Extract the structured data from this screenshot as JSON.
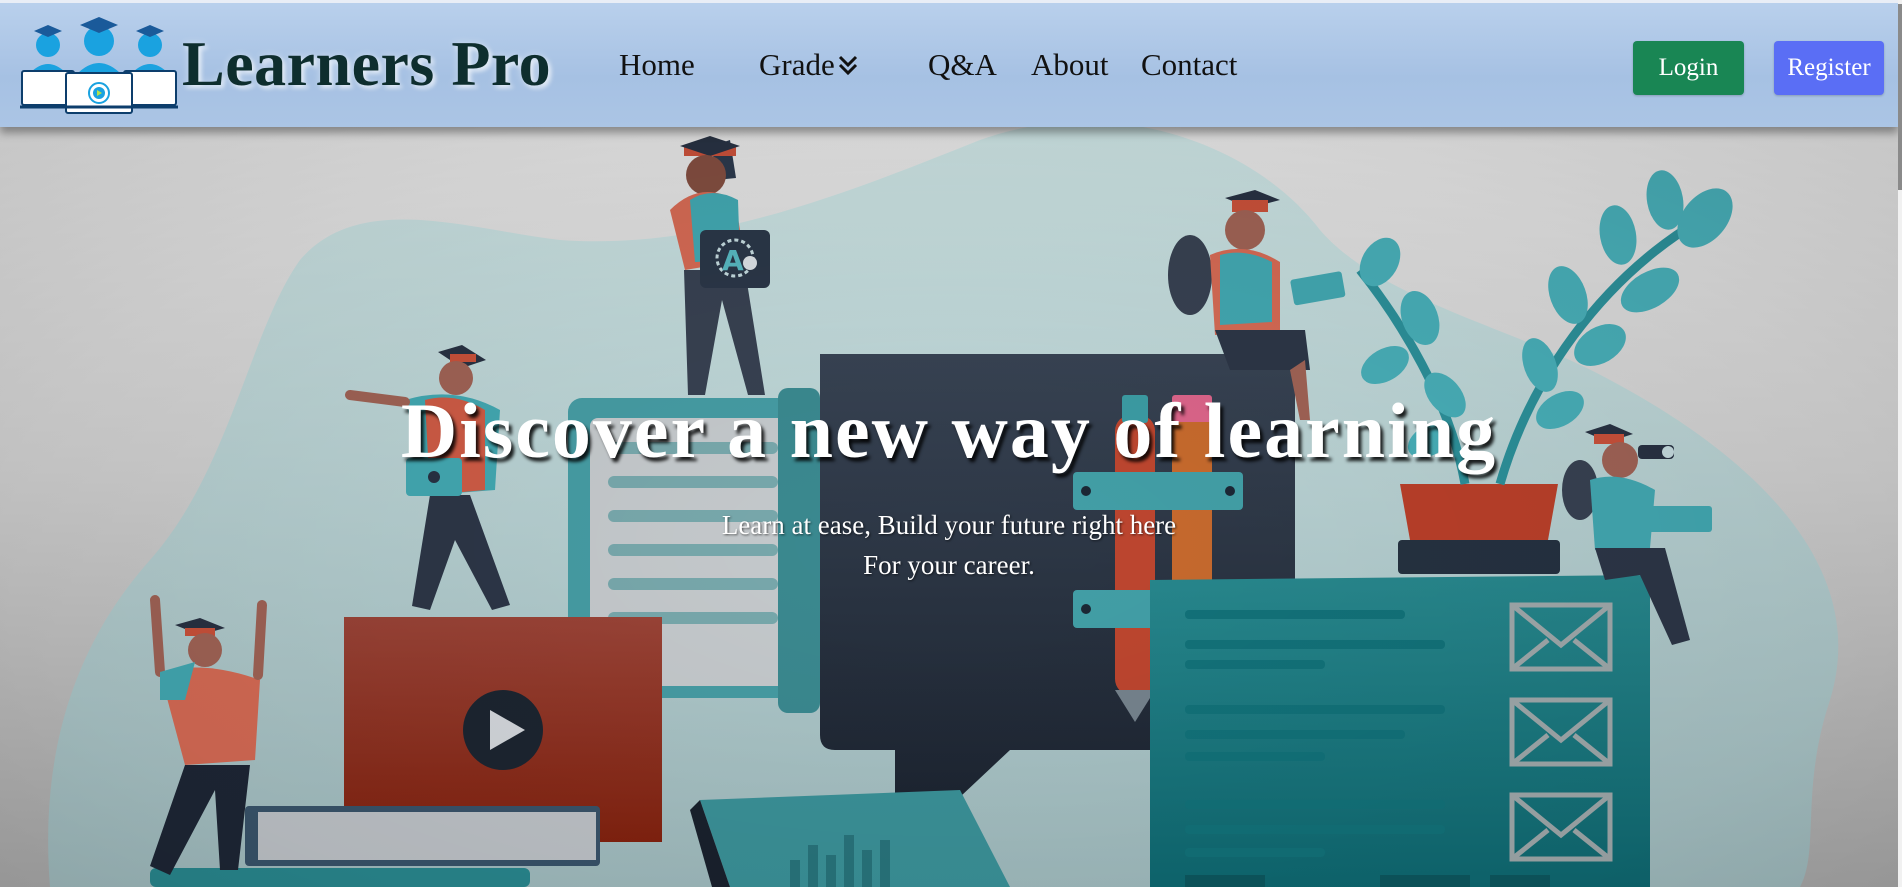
{
  "header": {
    "brand": "Learners Pro",
    "logo_icon": "students-graduation-cap-icon",
    "nav": {
      "home": "Home",
      "grade": "Grade",
      "qa": "Q&A",
      "about": "About",
      "contact": "Contact"
    },
    "grade_dropdown_icon": "double-chevron-down-icon",
    "login_label": "Login",
    "register_label": "Register"
  },
  "hero": {
    "title": "Discover a new way of learning",
    "subtitle_line1": "Learn at ease, Build your future right here",
    "subtitle_line2": "For your career.",
    "illustration": "students-learning-illustration"
  },
  "colors": {
    "header_bg": "#a6c1e3",
    "brand_text": "#0e2e2e",
    "login_bg": "#198654",
    "register_bg": "#5a6ef5",
    "teal": "#3aa7ae",
    "coral": "#d4553d",
    "navy": "#2b3446"
  }
}
